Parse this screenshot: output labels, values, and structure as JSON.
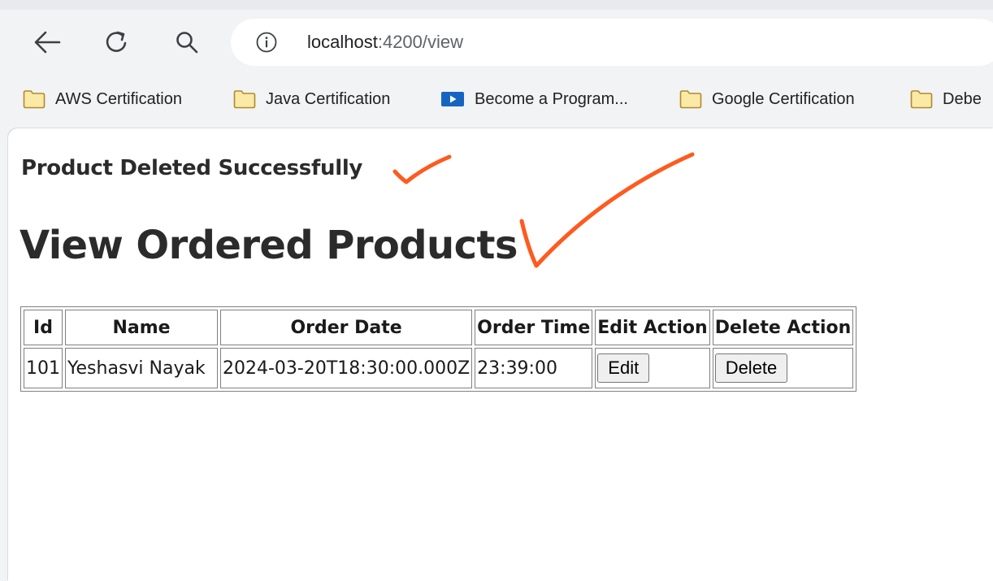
{
  "browser": {
    "url_host": "localhost",
    "url_rest": ":4200/view",
    "bookmarks": [
      {
        "label": "AWS Certification",
        "icon": "folder-icon"
      },
      {
        "label": "Java Certification",
        "icon": "folder-icon"
      },
      {
        "label": "Become a Program...",
        "icon": "play-icon"
      },
      {
        "label": "Google Certification",
        "icon": "folder-icon"
      },
      {
        "label": "Debe",
        "icon": "folder-icon"
      }
    ]
  },
  "page": {
    "message": "Product Deleted Successfully",
    "title": "View Ordered Products",
    "table": {
      "headers": [
        "Id",
        "Name",
        "Order Date",
        "Order Time",
        "Edit Action",
        "Delete Action"
      ],
      "rows": [
        {
          "id": "101",
          "name": "Yeshasvi Nayak",
          "order_date": "2024-03-20T18:30:00.000Z",
          "order_time": "23:39:00",
          "edit_label": "Edit",
          "delete_label": "Delete"
        }
      ]
    }
  },
  "colors": {
    "annotation": "#ff5a1f",
    "chrome_bg": "#f1f3f4",
    "folder_fill": "#fbe9a6",
    "folder_stroke": "#b08a2e",
    "play_bg": "#1565c0"
  }
}
